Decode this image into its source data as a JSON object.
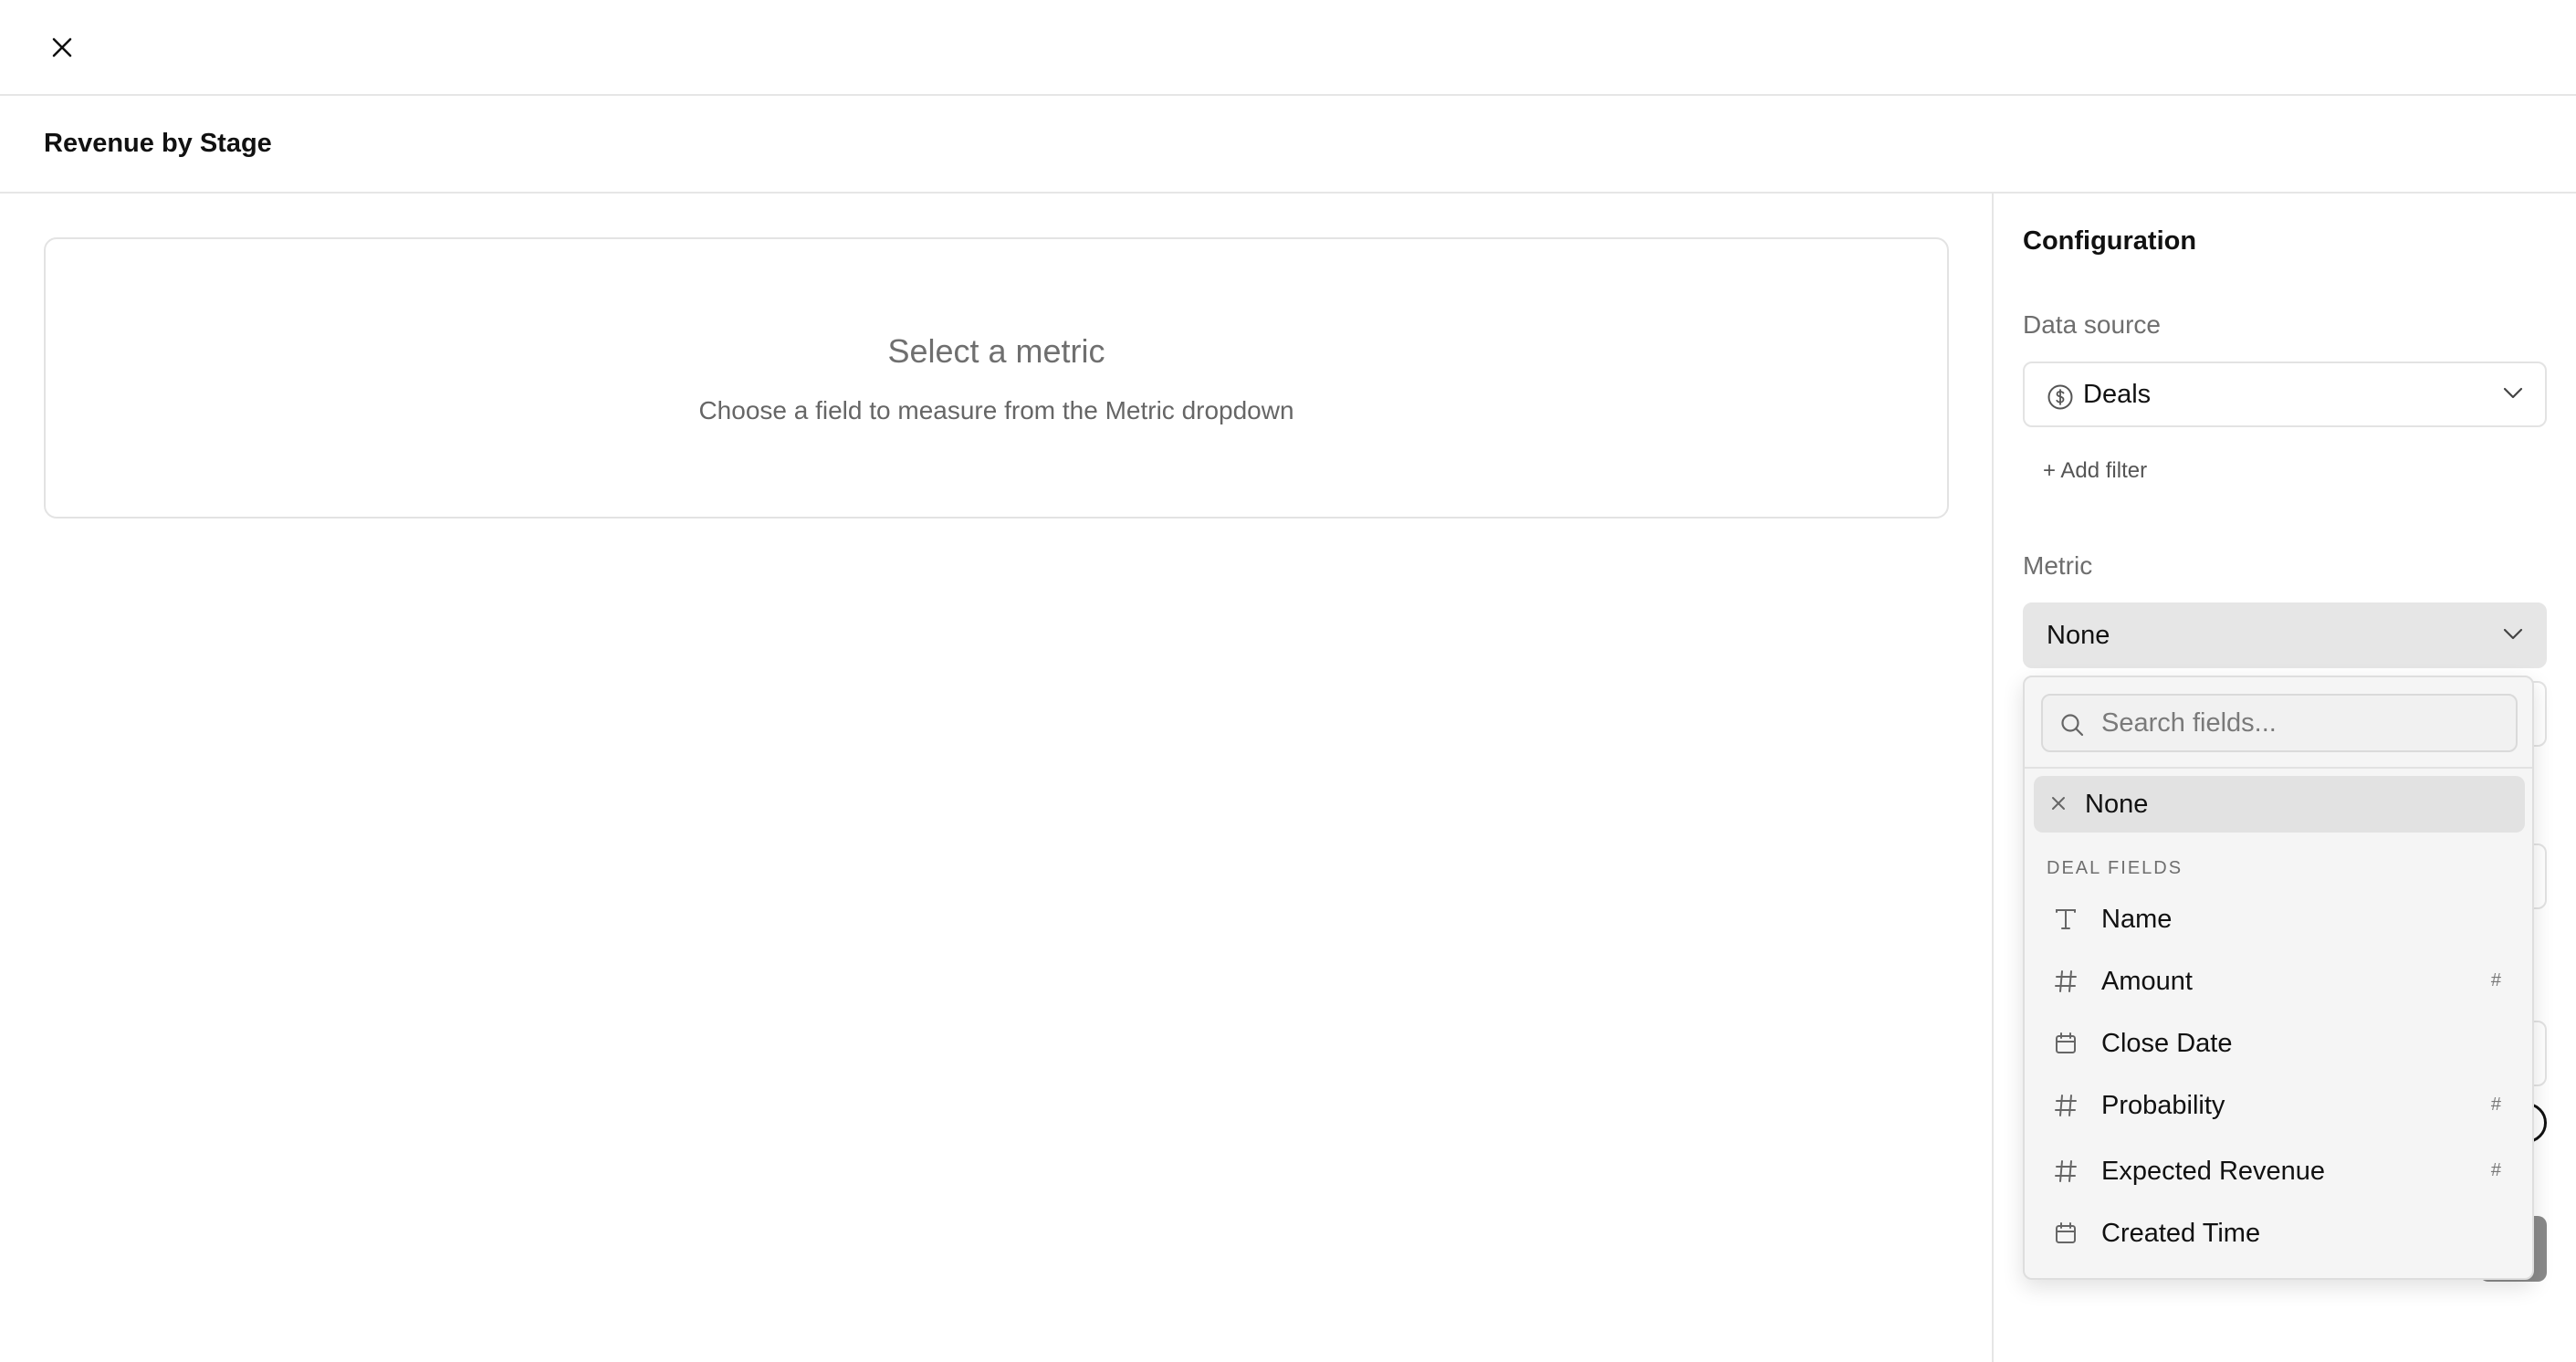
{
  "header": {
    "close_icon": "close-icon"
  },
  "page": {
    "title": "Revenue by Stage"
  },
  "preview": {
    "heading": "Select a metric",
    "subtext": "Choose a field to measure from the Metric dropdown"
  },
  "config": {
    "title": "Configuration",
    "data_source": {
      "label": "Data source",
      "value": "Deals",
      "icon": "dollar-circle-icon"
    },
    "add_filter_label": "+ Add filter",
    "metric": {
      "label": "Metric",
      "value": "None"
    }
  },
  "dropdown": {
    "search_placeholder": "Search fields...",
    "none_option": "None",
    "group_label": "DEAL FIELDS",
    "options": [
      {
        "label": "Name",
        "icon": "text-icon",
        "badge": ""
      },
      {
        "label": "Amount",
        "icon": "hash-icon",
        "badge": "#"
      },
      {
        "label": "Close Date",
        "icon": "calendar-icon",
        "badge": ""
      },
      {
        "label": "Probability",
        "icon": "hash-icon",
        "badge": "#"
      },
      {
        "label": "Expected Revenue",
        "icon": "hash-icon",
        "badge": "#"
      },
      {
        "label": "Created Time",
        "icon": "calendar-icon",
        "badge": ""
      }
    ]
  },
  "colors": {
    "border": "#e6e6e6",
    "selected_bg": "#e2e2e2",
    "muted_text": "#6e6e6e"
  }
}
